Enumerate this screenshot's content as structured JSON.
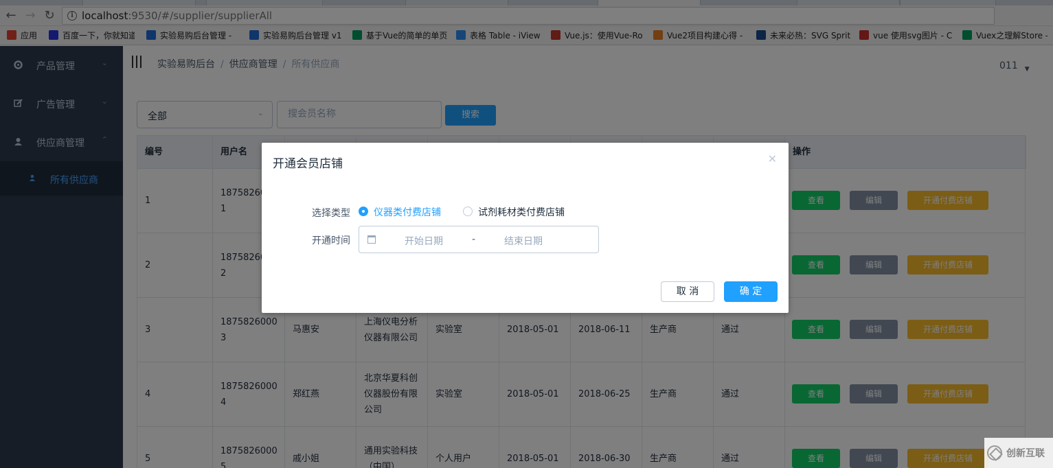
{
  "browser": {
    "url_host": "localhost",
    "url_rest": ":9530/#/supplier/supplierAll",
    "bookmarks": [
      {
        "label": "应用",
        "color": "#e34133"
      },
      {
        "label": "百度一下，你就知道",
        "color": "#2932e1"
      },
      {
        "label": "实验易购后台管理 - ",
        "color": "#1e6bd6"
      },
      {
        "label": "实验易购后台管理 v1",
        "color": "#1e6bd6"
      },
      {
        "label": "基于Vue的简单的单页",
        "color": "#009a61"
      },
      {
        "label": "表格 Table - iView",
        "color": "#2d8cf0"
      },
      {
        "label": "Vue.js：使用Vue-Ro",
        "color": "#c0392b"
      },
      {
        "label": "Vue2项目构建心得 -",
        "color": "#e67e22"
      },
      {
        "label": "未来必热：SVG Sprit",
        "color": "#1a4b8c"
      },
      {
        "label": "vue 使用svg图片 - C",
        "color": "#c9302c"
      },
      {
        "label": "Vuex之理解Store -",
        "color": "#009a61"
      }
    ]
  },
  "sidebar": {
    "items": [
      {
        "label": "产品管理",
        "icon": "gear-icon"
      },
      {
        "label": "广告管理",
        "icon": "edit-icon"
      },
      {
        "label": "供应商管理",
        "icon": "user-icon"
      }
    ],
    "sub_item": {
      "label": "所有供应商",
      "icon": "user-icon"
    }
  },
  "header": {
    "breadcrumb": [
      "实验易购后台",
      "供应商管理",
      "所有供应商"
    ],
    "user": "011"
  },
  "filter": {
    "select_value": "全部",
    "search_placeholder": "搜会员名称",
    "search_button": "搜索"
  },
  "table": {
    "columns": [
      "编号",
      "用户名",
      "",
      "",
      "",
      "",
      "",
      "",
      "",
      "操作"
    ],
    "rows": [
      {
        "id": "1",
        "username": "18758260\n1",
        "name": "",
        "company": "",
        "type": "",
        "start": "",
        "end": "",
        "role": "",
        "status": ""
      },
      {
        "id": "2",
        "username": "18758260\n2",
        "name": "",
        "company": "",
        "type": "",
        "start": "",
        "end": "",
        "role": "",
        "status": ""
      },
      {
        "id": "3",
        "username": "18758260003",
        "name": "马惠安",
        "company": "上海仪电分析仪器有限公司",
        "type": "实验室",
        "start": "2018-05-01",
        "end": "2018-06-11",
        "role": "生产商",
        "status": "通过"
      },
      {
        "id": "4",
        "username": "18758260004",
        "name": "郑红燕",
        "company": "北京华夏科创仪器股份有限公司",
        "type": "实验室",
        "start": "2018-05-01",
        "end": "2018-06-25",
        "role": "生产商",
        "status": "通过"
      },
      {
        "id": "5",
        "username": "18758260005",
        "name": "戚小姐",
        "company": "通用实验科技（中国）",
        "type": "个人用户",
        "start": "2018-05-01",
        "end": "2018-06-30",
        "role": "生产商",
        "status": "通过"
      }
    ],
    "actions": {
      "view": "查看",
      "edit": "编辑",
      "open": "开通付费店铺"
    }
  },
  "dialog": {
    "title": "开通会员店铺",
    "type_label": "选择类型",
    "options": [
      "仪器类付费店铺",
      "试剂耗材类付费店铺"
    ],
    "selected_option": "仪器类付费店铺",
    "time_label": "开通时间",
    "start_placeholder": "开始日期",
    "range_separator": "-",
    "end_placeholder": "结束日期",
    "cancel": "取 消",
    "confirm": "确 定"
  },
  "watermark": "创新互联",
  "colors": {
    "sidebar_bg": "#2e3a4c",
    "primary": "#20a0ff",
    "view_btn": "#13ce66",
    "edit_btn": "#8391a5",
    "open_btn": "#f7ba2a"
  }
}
